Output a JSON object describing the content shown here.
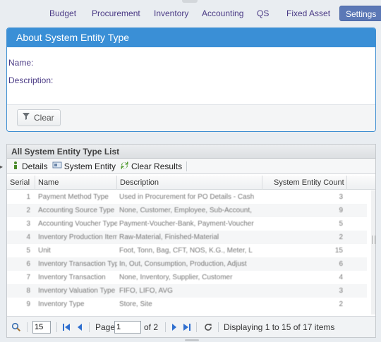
{
  "nav": {
    "items": [
      {
        "label": "Budget"
      },
      {
        "label": "Procurement"
      },
      {
        "label": "Inventory"
      },
      {
        "label": "Accounting"
      },
      {
        "label": "QS"
      },
      {
        "label": "Fixed Asset"
      },
      {
        "label": "Settings",
        "active": true
      }
    ]
  },
  "about": {
    "title": "About System Entity Type",
    "name_label": "Name:",
    "description_label": "Description:",
    "clear_label": "Clear"
  },
  "grid": {
    "title": "All System Entity Type List",
    "toolbar": {
      "details_label": "Details",
      "system_entity_label": "System Entity",
      "clear_results_label": "Clear Results"
    },
    "columns": {
      "serial": "Serial",
      "name": "Name",
      "description": "Description",
      "count": "System Entity Count"
    },
    "rows": [
      {
        "serial": "1",
        "name": "Payment Method Type",
        "description": "Used in Procurement for PO Details - Cash",
        "count": "3"
      },
      {
        "serial": "2",
        "name": "Accounting Source Type",
        "description": "None, Customer, Employee, Sub-Account,",
        "count": "9"
      },
      {
        "serial": "3",
        "name": "Accounting Voucher Type",
        "description": "Payment-Voucher-Bank, Payment-Voucher",
        "count": "5"
      },
      {
        "serial": "4",
        "name": "Inventory Production Item",
        "description": "Raw-Material, Finished-Material",
        "count": "2"
      },
      {
        "serial": "5",
        "name": "Unit",
        "description": "Foot, Tonn, Bag, CFT, NOS, K.G., Meter, L",
        "count": "15"
      },
      {
        "serial": "6",
        "name": "Inventory Transaction Type",
        "description": "In, Out, Consumption, Production, Adjust",
        "count": "6"
      },
      {
        "serial": "7",
        "name": "Inventory Transaction",
        "description": "None, Inventory, Supplier, Customer",
        "count": "4"
      },
      {
        "serial": "8",
        "name": "Inventory Valuation Type",
        "description": "FIFO, LIFO, AVG",
        "count": "3"
      },
      {
        "serial": "9",
        "name": "Inventory Type",
        "description": "Store, Site",
        "count": "2"
      }
    ],
    "pager": {
      "page_size": "15",
      "page_label": "Page",
      "page_value": "1",
      "of_label": "of 2",
      "display_text": "Displaying 1 to 15 of 17 items"
    }
  },
  "colors": {
    "accent": "#3a8fd6",
    "nav_text": "#4a3a85",
    "active_tab": "#5b78b6"
  }
}
